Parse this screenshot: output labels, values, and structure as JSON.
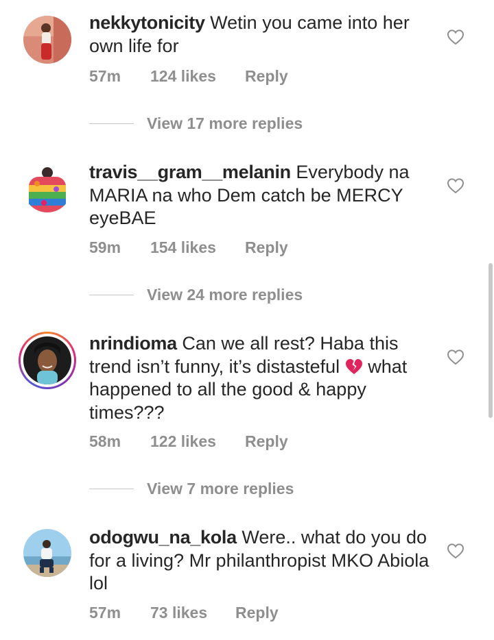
{
  "comments": [
    {
      "username": "nekkytonicity",
      "text": " Wetin you came into her own life for",
      "time": "57m",
      "likes": "124 likes",
      "reply": "Reply",
      "view_more": "View 17 more replies"
    },
    {
      "username": "travis__gram__melanin",
      "text": " Everybody na MARIA na who Dem catch be MERCY eyeBAE",
      "time": "59m",
      "likes": "154 likes",
      "reply": "Reply",
      "view_more": "View 24 more replies"
    },
    {
      "username": "nrindioma",
      "text": " Can we all rest? Haba this trend isn’t funny, it’s distasteful",
      "text_after": " what happened to all the good & happy times???",
      "emoji": "broken-heart-icon",
      "time": "58m",
      "likes": "122 likes",
      "reply": "Reply",
      "view_more": "View 7 more replies"
    },
    {
      "username": "odogwu_na_kola",
      "text": " Were.. what do you do for a living? Mr philanthropist MKO Abiola lol",
      "time": "57m",
      "likes": "73 likes",
      "reply": "Reply"
    }
  ],
  "icons": {
    "like": "heart-outline-icon"
  },
  "colors": {
    "text": "#262626",
    "secondary": "#8e8e8e",
    "divider": "#c7c7c7",
    "broken_heart": "#e0245e"
  }
}
